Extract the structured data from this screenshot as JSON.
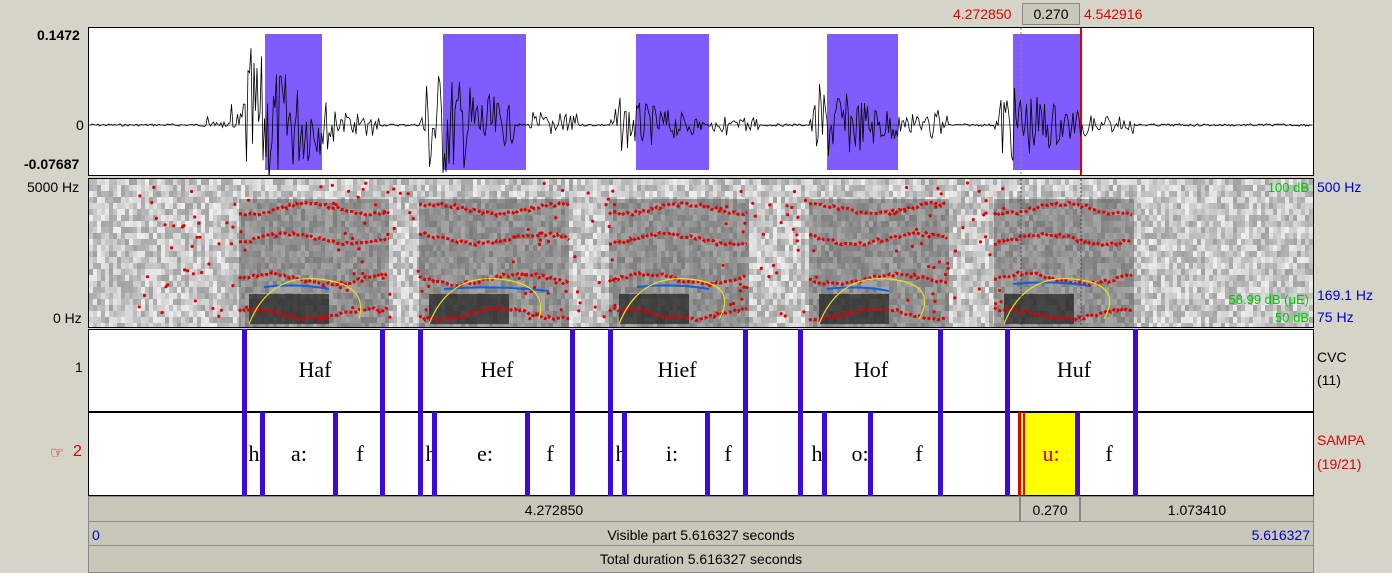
{
  "selection": {
    "start": "4.272850",
    "duration": "0.270",
    "end": "4.542916"
  },
  "waveform": {
    "ymax": "0.1472",
    "zero": "0",
    "ymin": "-0.07687"
  },
  "spectrogram": {
    "freq_top": "5000 Hz",
    "freq_bottom": "0 Hz",
    "intensity_top": "100 dB",
    "intensity_mid": "58.99 dB (μE)",
    "intensity_bottom": "50 dB",
    "pitch_top": "500 Hz",
    "pitch_mid": "169.1 Hz",
    "pitch_bottom": "75 Hz"
  },
  "tier1": {
    "number": "1",
    "name": "CVC",
    "count": "(11)",
    "intervals": [
      "Haf",
      "Hef",
      "Hief",
      "Hof",
      "Huf"
    ]
  },
  "tier2": {
    "pointer": "☞",
    "number": "2",
    "name": "SAMPA",
    "count": "(19/21)",
    "intervals": [
      "h",
      "a:",
      "f",
      "h",
      "e:",
      "f",
      "h",
      "i:",
      "f",
      "h",
      "o:",
      "f",
      "u:",
      "f"
    ]
  },
  "bottom": {
    "left_segment": "4.272850",
    "selection_segment": "0.270",
    "right_segment": "1.073410",
    "visible_start": "0",
    "visible_label": "Visible part 5.616327 seconds",
    "visible_end": "5.616327",
    "total_label": "Total duration 5.616327 seconds"
  },
  "colors": {
    "boundary": "#3a0ad8",
    "selection_fill": "#ffff00",
    "formant": "#e00000",
    "pitch": "#1060e0",
    "intensity": "#e8e020",
    "voiced_fill": "#6a40ff"
  }
}
